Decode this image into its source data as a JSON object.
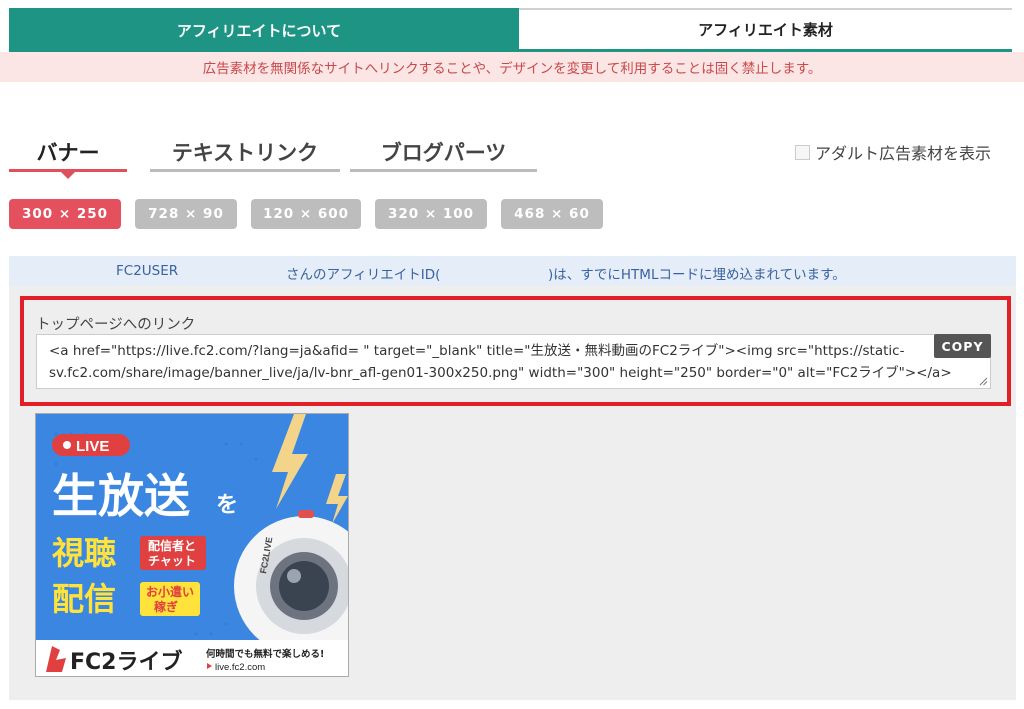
{
  "top_tabs": {
    "about": "アフィリエイトについて",
    "materials": "アフィリエイト素材"
  },
  "warning": "広告素材を無関係なサイトへリンクすることや、デザインを変更して利用することは固く禁止します。",
  "sub_tabs": {
    "banner": "バナー",
    "text_link": "テキストリンク",
    "blog_parts": "ブログパーツ"
  },
  "adult_toggle": "アダルト広告素材を表示",
  "sizes": [
    "300 × 250",
    "728 × 90",
    "120 × 600",
    "320 × 100",
    "468 × 60"
  ],
  "info": {
    "user": "FC2USER",
    "text_left": "さんのアフィリエイトID(",
    "text_right": ")は、すでにHTMLコードに埋め込まれています。"
  },
  "code": {
    "label": "トップページへのリンク",
    "line1": "<a href=\"https://live.fc2.com/?lang=ja&afid=                \" target=\"_blank\" title=\"生放送・無料動画のFC2ライブ\"><img src=\"https://static-",
    "line2": "sv.fc2.com/share/image/banner_live/ja/lv-bnr_afl-gen01-300x250.png\" width=\"300\" height=\"250\" border=\"0\" alt=\"FC2ライブ\"></a>",
    "copy": "COPY"
  },
  "banner": {
    "live": "LIVE",
    "main": "生放送",
    "wo": "を",
    "view": "視聴",
    "stream": "配信",
    "bubble1a": "配信者と",
    "bubble1b": "チャット",
    "bubble2a": "お小遣い",
    "bubble2b": "稼ぎ",
    "brand": "FC2ライブ",
    "tagline": "何時間でも無料で楽しめる!",
    "url": "live.fc2.com",
    "lens_text": "FC2LIVE",
    "colors": {
      "blue": "#3a86e0",
      "yellow": "#ffe23a",
      "red": "#e04040"
    }
  }
}
